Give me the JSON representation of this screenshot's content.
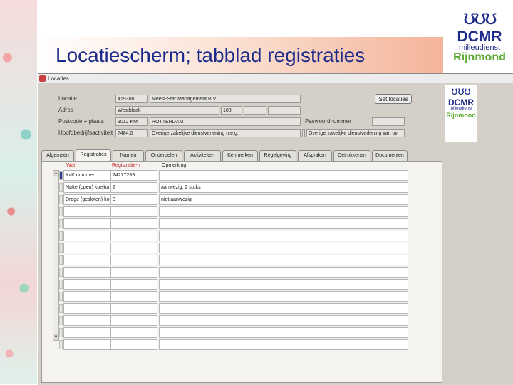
{
  "slide": {
    "title": "Locatiescherm; tabblad registraties",
    "logo": {
      "mark": "ʊʊʊ",
      "line1": "DCMR",
      "line2": "milieudienst",
      "line3": "Rijnmond"
    }
  },
  "window": {
    "title": "Locaties",
    "side_logo": {
      "mark": "ʊʊʊ",
      "line1": "DCMR",
      "line2": "milieudienst",
      "line3": "Rijnmond"
    }
  },
  "form": {
    "locatie": {
      "label": "Locatie",
      "code": "419300",
      "name": "Meest-Star Management B.V."
    },
    "adres": {
      "label": "Adres",
      "street": "Westblaak",
      "number": "108",
      "extra1": "",
      "extra2": ""
    },
    "postcode": {
      "label": "Postcode + plaats",
      "postcode": "3012 KM",
      "plaats": "ROTTERDAM"
    },
    "hoofdbedrijf": {
      "label": "Hoofdbedrijfsactiviteit",
      "code": "7484.0",
      "desc": "Overige zakelijke dienstverlening n.e.g."
    },
    "button_label": "Set locaties",
    "paswoord": {
      "label": "Paswoordnummer",
      "value": ""
    },
    "blank_field": "",
    "right_desc": "Overige zakelijke dienstverlening van ov"
  },
  "tabs": [
    "Algemeen",
    "Registraties",
    "Namen",
    "Onderdelen",
    "Activiteiten",
    "Kenmerken",
    "Regelgeving",
    "Afspraken",
    "Detrokkenen",
    "Documenten"
  ],
  "active_tab": 1,
  "table": {
    "headers": [
      "Wat",
      "Registratie-n",
      "Opmerking"
    ],
    "rows": [
      [
        "KvK nummer",
        "24277289",
        ""
      ],
      [
        "Natte (open) koeltor",
        "2",
        "aanwezig, 2 stuks"
      ],
      [
        "Droge (gesloten) ko",
        "0",
        "niet aanwezig"
      ],
      [
        "",
        "",
        ""
      ],
      [
        "",
        "",
        ""
      ],
      [
        "",
        "",
        ""
      ],
      [
        "",
        "",
        ""
      ],
      [
        "",
        "",
        ""
      ],
      [
        "",
        "",
        ""
      ],
      [
        "",
        "",
        ""
      ],
      [
        "",
        "",
        ""
      ],
      [
        "",
        "",
        ""
      ],
      [
        "",
        "",
        ""
      ],
      [
        "",
        "",
        ""
      ],
      [
        "",
        "",
        ""
      ]
    ]
  },
  "colors": {
    "title": "#1d2b8a",
    "logo_green": "#5aa832",
    "header_red": "#c02020"
  }
}
